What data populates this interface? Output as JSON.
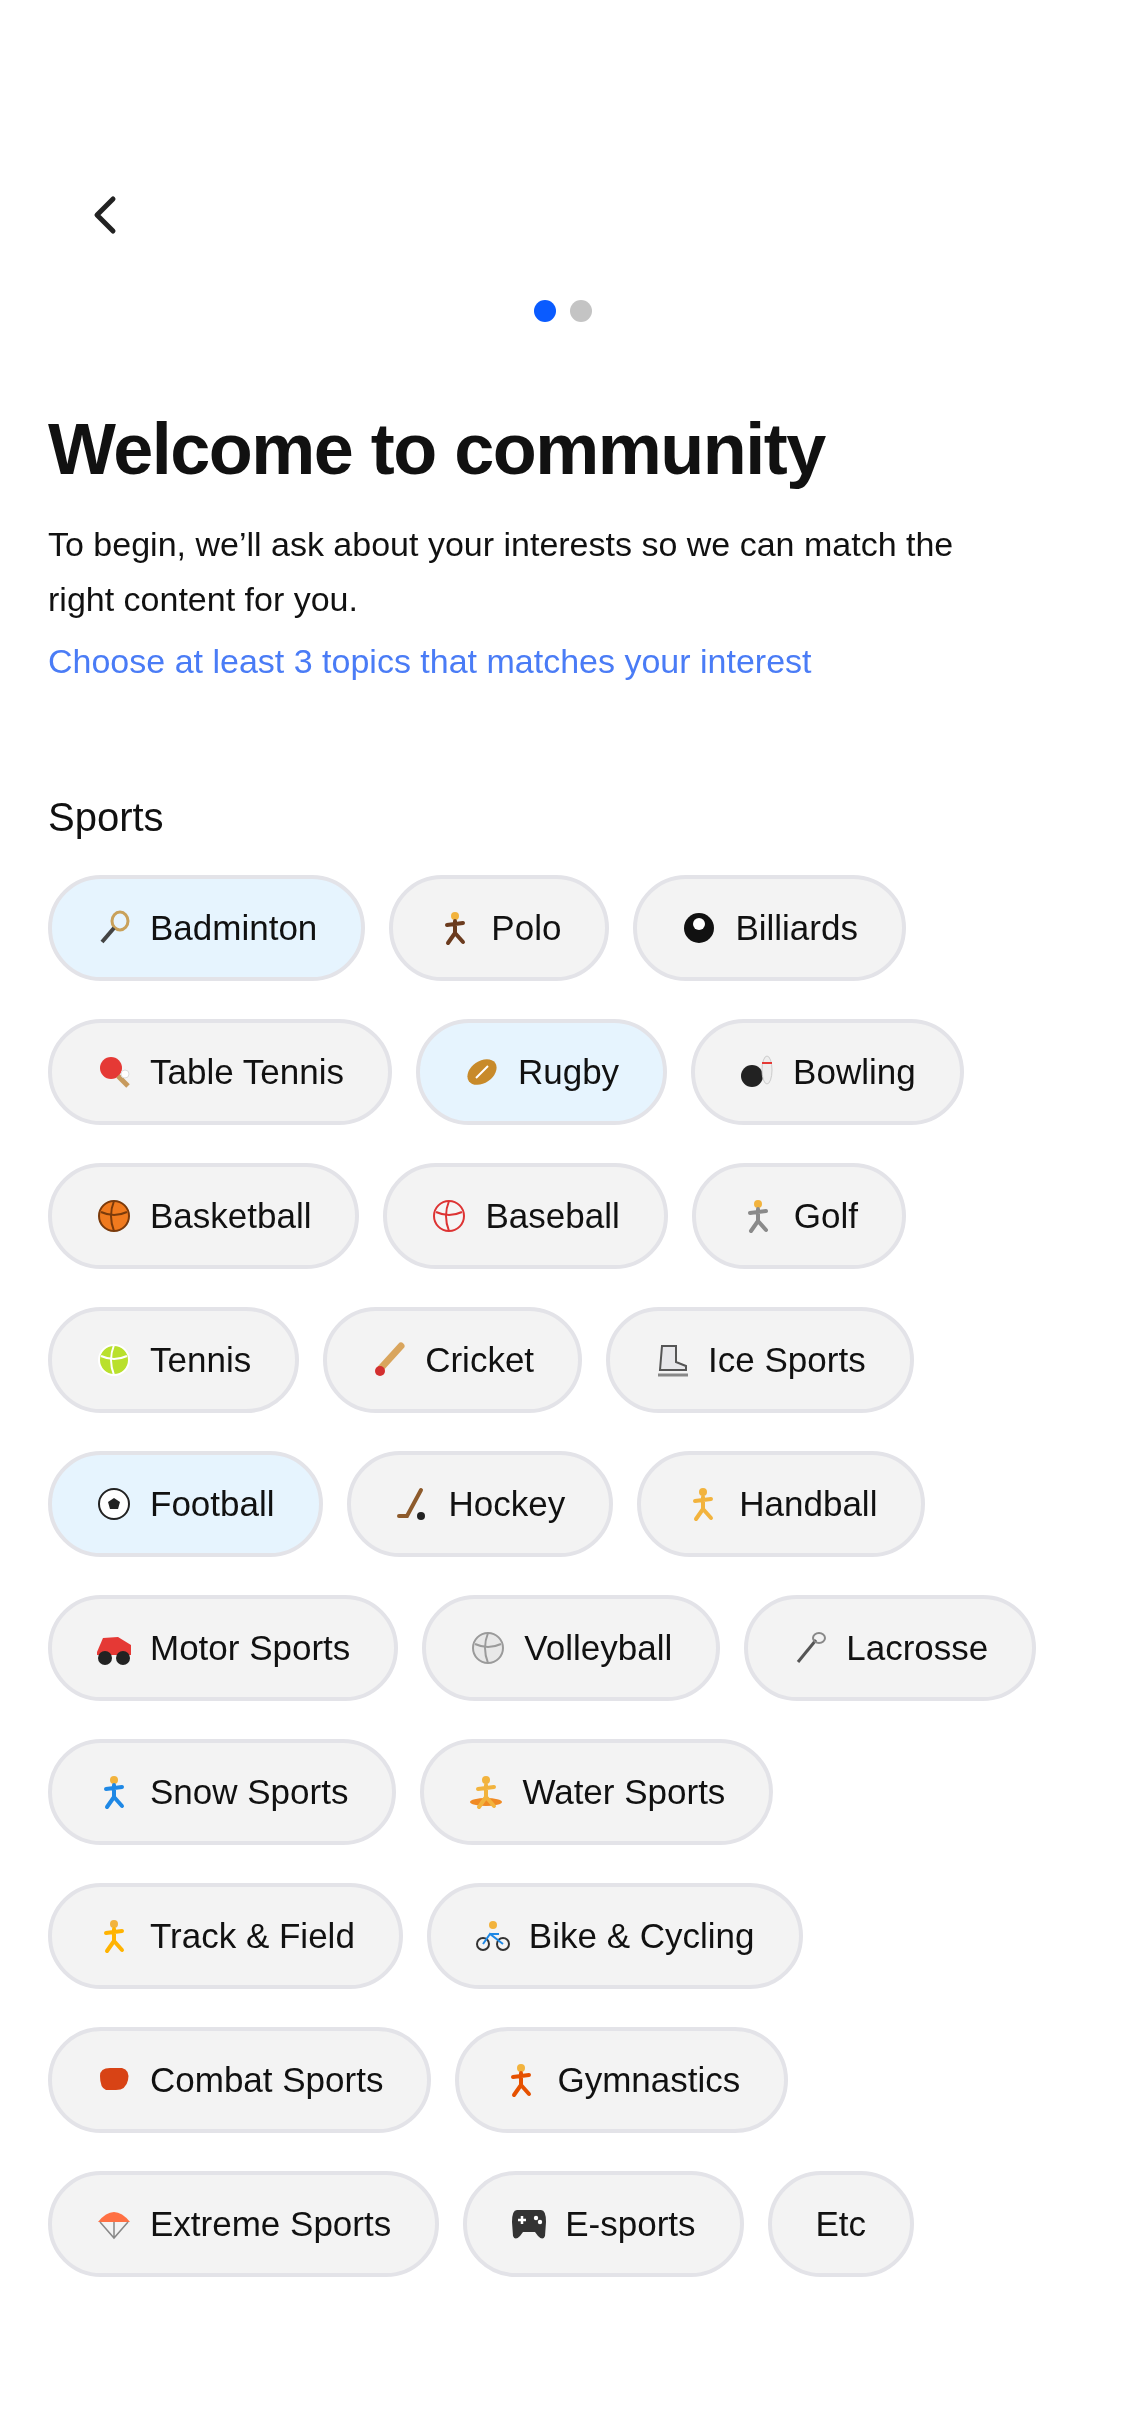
{
  "pager": [
    {
      "selected": true
    },
    {
      "selected": false
    }
  ],
  "title": "Welcome to community",
  "intro": "To begin, we’ll ask about your interests so we can match the right content for you.",
  "hint": "Choose at least 3 topics that matches your interest",
  "section": {
    "title": "Sports",
    "topics": [
      {
        "label": "Badminton",
        "selected": true
      },
      {
        "label": "Polo",
        "selected": false
      },
      {
        "label": "Billiards",
        "selected": false
      },
      {
        "label": "Table Tennis",
        "selected": false
      },
      {
        "label": "Rugby",
        "selected": true
      },
      {
        "label": "Bowling",
        "selected": false
      },
      {
        "label": "Basketball",
        "selected": false
      },
      {
        "label": "Baseball",
        "selected": false
      },
      {
        "label": "Golf",
        "selected": false
      },
      {
        "label": "Tennis",
        "selected": false
      },
      {
        "label": "Cricket",
        "selected": false
      },
      {
        "label": "Ice Sports",
        "selected": false
      },
      {
        "label": "Football",
        "selected": true
      },
      {
        "label": "Hockey",
        "selected": false
      },
      {
        "label": "Handball",
        "selected": false
      },
      {
        "label": "Motor Sports",
        "selected": false
      },
      {
        "label": "Volleyball",
        "selected": false
      },
      {
        "label": "Lacrosse",
        "selected": false
      },
      {
        "label": "Snow Sports",
        "selected": false
      },
      {
        "label": "Water Sports",
        "selected": false
      },
      {
        "label": "Track & Field",
        "selected": false
      },
      {
        "label": "Bike & Cycling",
        "selected": false
      },
      {
        "label": "Combat Sports",
        "selected": false
      },
      {
        "label": "Gymnastics",
        "selected": false
      },
      {
        "label": "Extreme Sports",
        "selected": false
      },
      {
        "label": "E-sports",
        "selected": false
      },
      {
        "label": "Etc",
        "selected": false
      }
    ]
  }
}
